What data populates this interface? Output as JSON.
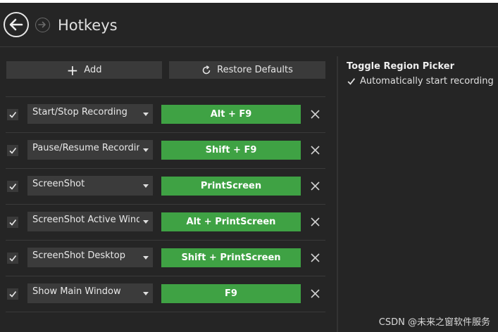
{
  "header": {
    "title": "Hotkeys"
  },
  "toolbar": {
    "add_label": "Add",
    "restore_label": "Restore Defaults"
  },
  "hotkeys": [
    {
      "enabled": true,
      "action": "Start/Stop Recording",
      "keys": "Alt + F9"
    },
    {
      "enabled": true,
      "action": "Pause/Resume Recording",
      "keys": "Shift + F9"
    },
    {
      "enabled": true,
      "action": "ScreenShot",
      "keys": "PrintScreen"
    },
    {
      "enabled": true,
      "action": "ScreenShot Active Window",
      "keys": "Alt + PrintScreen"
    },
    {
      "enabled": true,
      "action": "ScreenShot Desktop",
      "keys": "Shift + PrintScreen"
    },
    {
      "enabled": true,
      "action": "Show Main Window",
      "keys": "F9"
    }
  ],
  "side_panel": {
    "title": "Toggle Region Picker",
    "option_label": "Automatically start recording",
    "option_checked": true
  },
  "watermark": "CSDN @未来之窗软件服务",
  "colors": {
    "background": "#252525",
    "key_green": "#3fa244",
    "control_gray": "#3a3a3a"
  },
  "icons": {
    "back": "arrow-left-icon",
    "forward": "arrow-right-icon",
    "add": "plus-icon",
    "restore": "refresh-icon",
    "delete": "close-icon",
    "dropdown": "caret-down-icon",
    "check": "check-icon"
  }
}
